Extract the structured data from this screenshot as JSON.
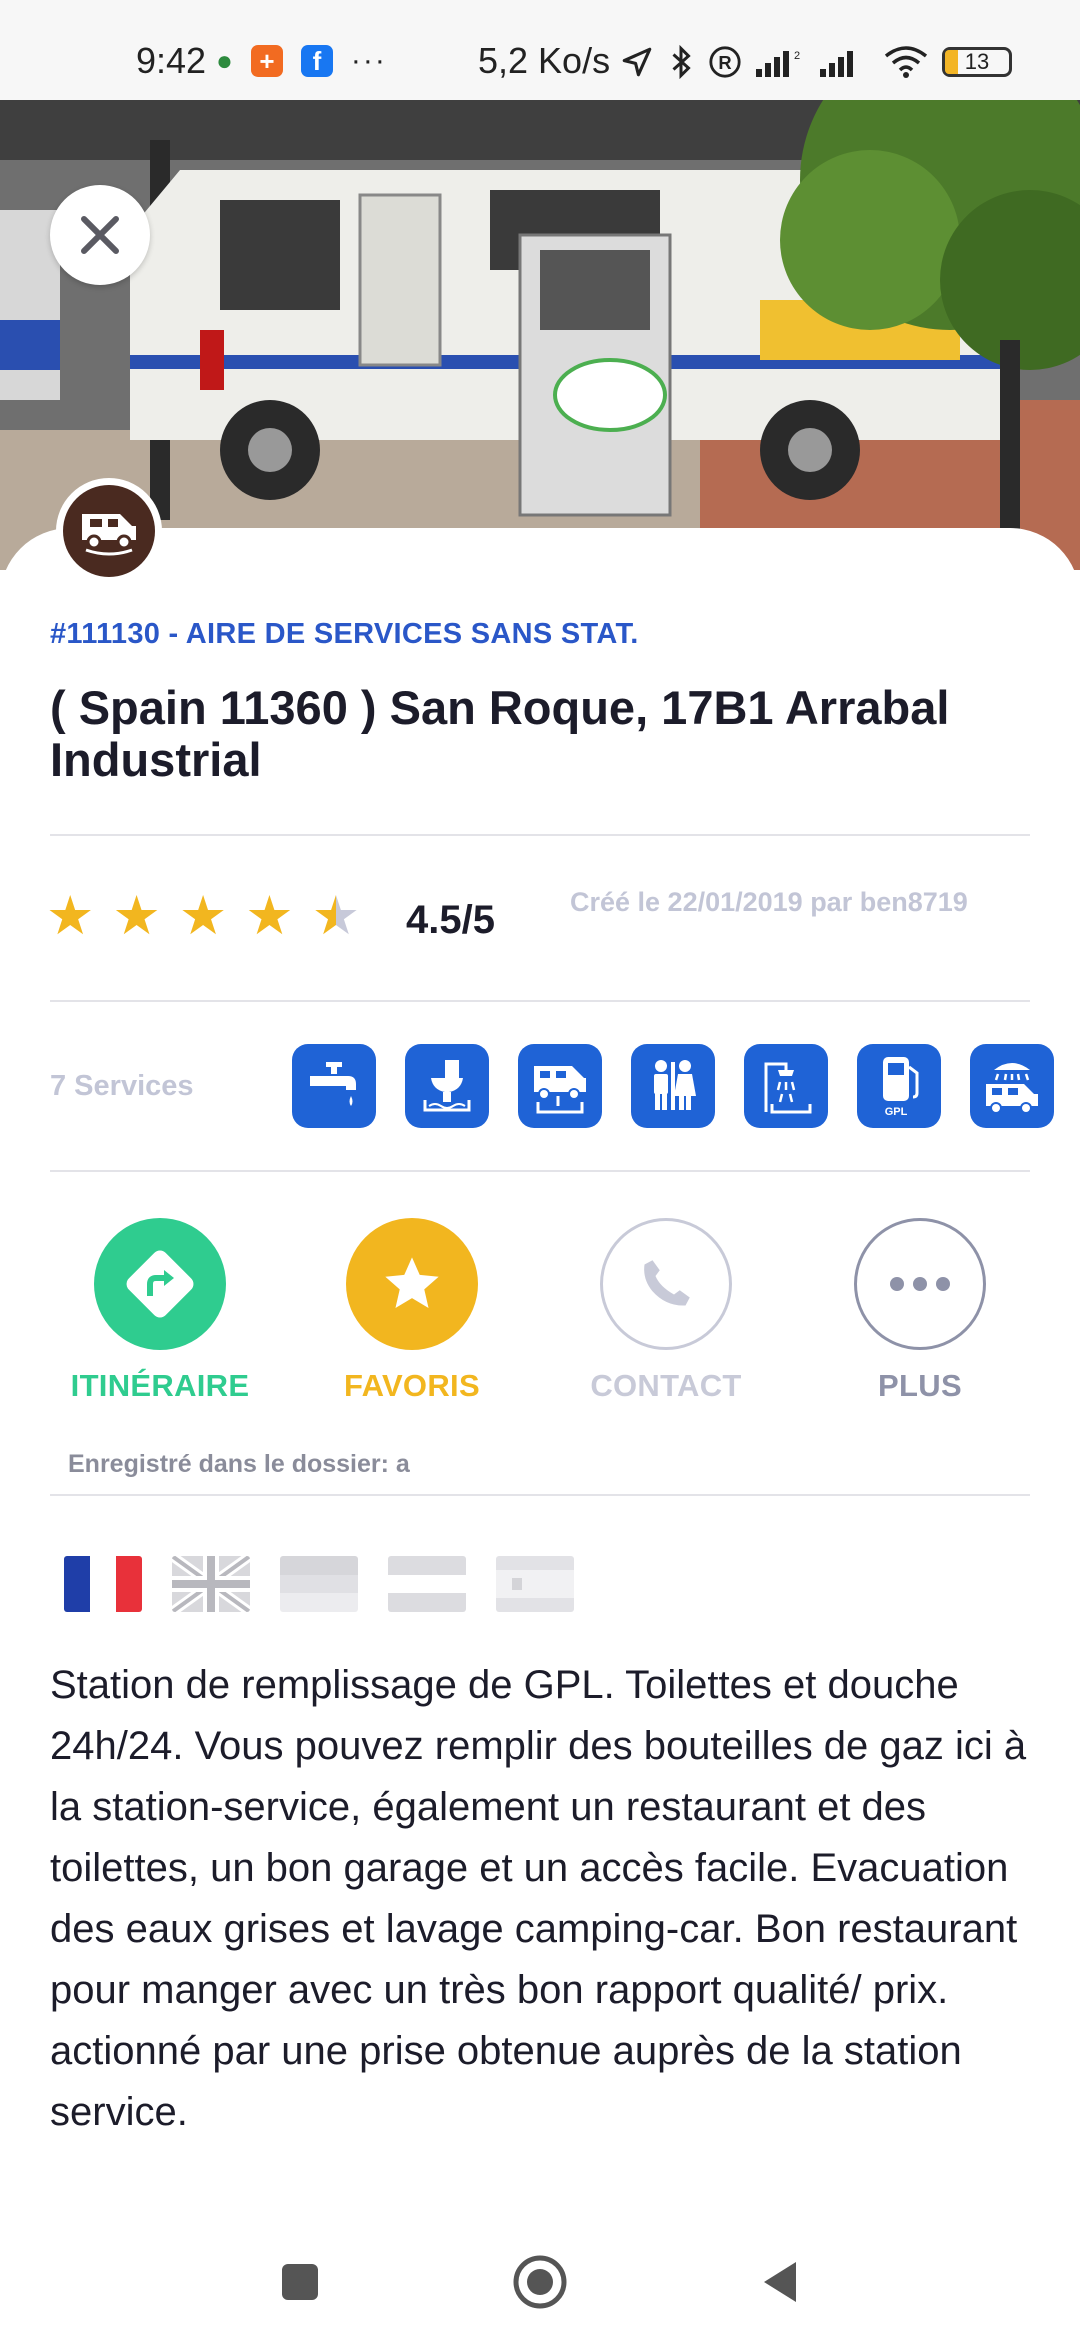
{
  "status_bar": {
    "time": "9:42",
    "network_speed": "5,2 Ko/s",
    "battery_level": "13",
    "more_notifications": "···"
  },
  "hero": {
    "slide_count": 3,
    "active_slide": 1
  },
  "place": {
    "reference": "#111130 - AIRE DE SERVICES SANS STAT.",
    "title": "( Spain 11360 ) San Roque, 17B1 Arrabal Industrial",
    "rating_value": 4.5,
    "rating_text": "4.5/5",
    "created_text": "Créé le 22/01/2019 par ben8719"
  },
  "services": {
    "label": "7 Services",
    "items": [
      {
        "icon": "water-tap-icon"
      },
      {
        "icon": "black-water-dump-icon"
      },
      {
        "icon": "grey-water-drain-icon"
      },
      {
        "icon": "toilets-icon"
      },
      {
        "icon": "shower-icon"
      },
      {
        "icon": "lpg-pump-icon",
        "text": "GPL"
      },
      {
        "icon": "motorhome-wash-icon"
      }
    ]
  },
  "actions": {
    "itinerary": "ITINÉRAIRE",
    "favorites": "FAVORIS",
    "contact": "CONTACT",
    "more": "PLUS"
  },
  "saved_folder_text": "Enregistré dans le dossier: a",
  "languages": [
    {
      "icon": "flag-fr-icon",
      "active": true
    },
    {
      "icon": "flag-uk-icon",
      "active": false
    },
    {
      "icon": "flag-de-icon",
      "active": false
    },
    {
      "icon": "flag-nl-icon",
      "active": false
    },
    {
      "icon": "flag-es-icon",
      "active": false
    }
  ],
  "description": "Station de remplissage de GPL. Toilettes et douche 24h/24. Vous pouvez remplir des bouteilles de gaz ici à la station-service, également un restaurant et des toilettes, un bon garage et un accès facile. Evacuation des eaux grises et lavage camping-car. Bon restaurant pour manger avec un très bon rapport qualité/ prix. actionné par une prise obtenue auprès de la station service.",
  "colors": {
    "accent_blue": "#1f63d6",
    "itinerary_green": "#2fcc8f",
    "favorite_yellow": "#f2b61f",
    "muted_gray": "#c2c5d6"
  }
}
